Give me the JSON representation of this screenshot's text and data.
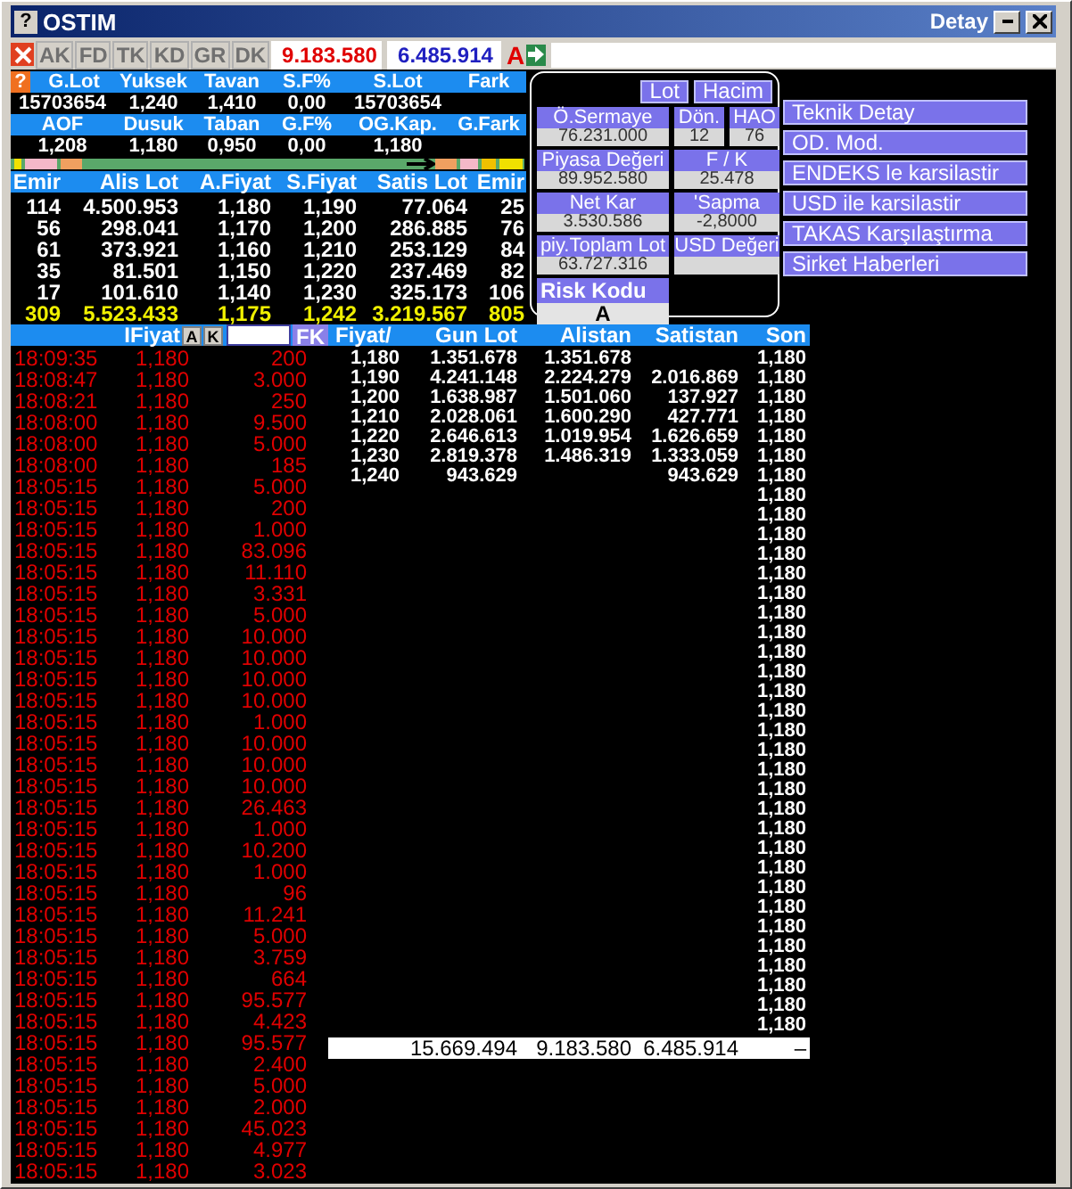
{
  "window": {
    "help": "?",
    "title": "OSTIM",
    "detail_title": "Detay"
  },
  "toolbar": {
    "buttons": [
      {
        "label": "AK",
        "disabled": true
      },
      {
        "label": "FD",
        "disabled": true
      },
      {
        "label": "TK",
        "disabled": true
      },
      {
        "label": "KD",
        "disabled": true
      },
      {
        "label": "GR",
        "disabled": true
      },
      {
        "label": "DK",
        "disabled": true
      }
    ],
    "buy_total": "9.183.580",
    "sell_total": "6.485.914",
    "mode": "A"
  },
  "summary": {
    "help": "?",
    "rows": [
      {
        "kind": "header",
        "cells": [
          "G.Lot",
          "Yuksek",
          "Tavan",
          "S.F%",
          "S.Lot",
          "Fark"
        ]
      },
      {
        "kind": "value",
        "cells": [
          "15703654",
          "1,240",
          "1,410",
          "0,00",
          "15703654"
        ]
      },
      {
        "kind": "header",
        "cells": [
          "AOF",
          "Dusuk",
          "Taban",
          "G.F%",
          "OG.Kap.",
          "G.Fark"
        ]
      },
      {
        "kind": "value",
        "cells": [
          "1,208",
          "1,180",
          "0,950",
          "0,00",
          "1,180"
        ]
      }
    ]
  },
  "order_book": {
    "columns": [
      "Emir",
      "Alis Lot",
      "A.Fiyat",
      "S.Fiyat",
      "Satis Lot",
      "Emir"
    ],
    "rows": [
      {
        "cells": [
          "114",
          "4.500.953",
          "1,180",
          "1,190",
          "77.064",
          "25"
        ],
        "total": false
      },
      {
        "cells": [
          "56",
          "298.041",
          "1,170",
          "1,200",
          "286.885",
          "76"
        ],
        "total": false
      },
      {
        "cells": [
          "61",
          "373.921",
          "1,160",
          "1,210",
          "253.129",
          "84"
        ],
        "total": false
      },
      {
        "cells": [
          "35",
          "81.501",
          "1,150",
          "1,220",
          "237.469",
          "82"
        ],
        "total": false
      },
      {
        "cells": [
          "17",
          "101.610",
          "1,140",
          "1,230",
          "325.173",
          "106"
        ],
        "total": false
      },
      {
        "cells": [
          "309",
          "5.523.433",
          "1,175",
          "1,242",
          "3.219.567",
          "805"
        ],
        "total": true
      }
    ]
  },
  "panel": {
    "toggles": [
      {
        "label": "Lot"
      },
      {
        "label": "Hacim"
      }
    ],
    "fields": [
      {
        "kind": "main",
        "label": "Ö.Sermaye",
        "value": "76.231.000"
      },
      {
        "kind": "small",
        "label": "Dön.",
        "value": "12"
      },
      {
        "kind": "small",
        "label": "HAO",
        "value": "76"
      },
      {
        "kind": "main",
        "label": "Piyasa Değeri",
        "value": "89.952.580"
      },
      {
        "kind": "side",
        "label": "F / K",
        "value": "25.478"
      },
      {
        "kind": "main",
        "label": "Net Kar",
        "value": "3.530.586"
      },
      {
        "kind": "side",
        "label": "'Sapma",
        "value": "-2,8000"
      },
      {
        "kind": "main",
        "label": "piy.Toplam Lot",
        "value": "63.727.316"
      },
      {
        "kind": "side",
        "label": "USD Değeri"
      }
    ],
    "risk": {
      "label": "Risk Kodu",
      "value": "A"
    }
  },
  "actions": [
    "Teknik Detay",
    "OD. Mod.",
    "ENDEKS le karsilastir",
    "USD ile karsilastir",
    "TAKAS Karşılaştırma",
    "Sirket Haberleri"
  ],
  "trades": {
    "price_label": "IFiyat",
    "buttons": [
      "A",
      "K"
    ],
    "filter_button": "FK",
    "rows": [
      {
        "time": "18:09:35",
        "price": "1,180",
        "lot": "200"
      },
      {
        "time": "18:08:47",
        "price": "1,180",
        "lot": "3.000"
      },
      {
        "time": "18:08:21",
        "price": "1,180",
        "lot": "250"
      },
      {
        "time": "18:08:00",
        "price": "1,180",
        "lot": "9.500"
      },
      {
        "time": "18:08:00",
        "price": "1,180",
        "lot": "5.000"
      },
      {
        "time": "18:08:00",
        "price": "1,180",
        "lot": "185"
      },
      {
        "time": "18:05:15",
        "price": "1,180",
        "lot": "5.000"
      },
      {
        "time": "18:05:15",
        "price": "1,180",
        "lot": "200"
      },
      {
        "time": "18:05:15",
        "price": "1,180",
        "lot": "1.000"
      },
      {
        "time": "18:05:15",
        "price": "1,180",
        "lot": "83.096"
      },
      {
        "time": "18:05:15",
        "price": "1,180",
        "lot": "11.110"
      },
      {
        "time": "18:05:15",
        "price": "1,180",
        "lot": "3.331"
      },
      {
        "time": "18:05:15",
        "price": "1,180",
        "lot": "5.000"
      },
      {
        "time": "18:05:15",
        "price": "1,180",
        "lot": "10.000"
      },
      {
        "time": "18:05:15",
        "price": "1,180",
        "lot": "10.000"
      },
      {
        "time": "18:05:15",
        "price": "1,180",
        "lot": "10.000"
      },
      {
        "time": "18:05:15",
        "price": "1,180",
        "lot": "10.000"
      },
      {
        "time": "18:05:15",
        "price": "1,180",
        "lot": "1.000"
      },
      {
        "time": "18:05:15",
        "price": "1,180",
        "lot": "10.000"
      },
      {
        "time": "18:05:15",
        "price": "1,180",
        "lot": "10.000"
      },
      {
        "time": "18:05:15",
        "price": "1,180",
        "lot": "10.000"
      },
      {
        "time": "18:05:15",
        "price": "1,180",
        "lot": "26.463"
      },
      {
        "time": "18:05:15",
        "price": "1,180",
        "lot": "1.000"
      },
      {
        "time": "18:05:15",
        "price": "1,180",
        "lot": "10.200"
      },
      {
        "time": "18:05:15",
        "price": "1,180",
        "lot": "1.000"
      },
      {
        "time": "18:05:15",
        "price": "1,180",
        "lot": "96"
      },
      {
        "time": "18:05:15",
        "price": "1,180",
        "lot": "11.241"
      },
      {
        "time": "18:05:15",
        "price": "1,180",
        "lot": "5.000"
      },
      {
        "time": "18:05:15",
        "price": "1,180",
        "lot": "3.759"
      },
      {
        "time": "18:05:15",
        "price": "1,180",
        "lot": "664"
      },
      {
        "time": "18:05:15",
        "price": "1,180",
        "lot": "95.577"
      },
      {
        "time": "18:05:15",
        "price": "1,180",
        "lot": "4.423"
      },
      {
        "time": "18:05:15",
        "price": "1,180",
        "lot": "95.577"
      },
      {
        "time": "18:05:15",
        "price": "1,180",
        "lot": "2.400"
      },
      {
        "time": "18:05:15",
        "price": "1,180",
        "lot": "5.000"
      },
      {
        "time": "18:05:15",
        "price": "1,180",
        "lot": "2.000"
      },
      {
        "time": "18:05:15",
        "price": "1,180",
        "lot": "45.023"
      },
      {
        "time": "18:05:15",
        "price": "1,180",
        "lot": "4.977"
      },
      {
        "time": "18:05:15",
        "price": "1,180",
        "lot": "3.023"
      }
    ]
  },
  "price_table": {
    "columns": [
      "Fiyat/",
      "Gun Lot",
      "Alistan",
      "Satistan",
      "Son"
    ],
    "rows": [
      {
        "fiyat": "1,180",
        "gun_lot": "1.351.678",
        "alistan": "1.351.678",
        "son": "1,180"
      },
      {
        "fiyat": "1,190",
        "gun_lot": "4.241.148",
        "alistan": "2.224.279",
        "satistan": "2.016.869",
        "son": "1,180"
      },
      {
        "fiyat": "1,200",
        "gun_lot": "1.638.987",
        "alistan": "1.501.060",
        "satistan": "137.927",
        "son": "1,180"
      },
      {
        "fiyat": "1,210",
        "gun_lot": "2.028.061",
        "alistan": "1.600.290",
        "satistan": "427.771",
        "son": "1,180"
      },
      {
        "fiyat": "1,220",
        "gun_lot": "2.646.613",
        "alistan": "1.019.954",
        "satistan": "1.626.659",
        "son": "1,180"
      },
      {
        "fiyat": "1,230",
        "gun_lot": "2.819.378",
        "alistan": "1.486.319",
        "satistan": "1.333.059",
        "son": "1,180"
      },
      {
        "fiyat": "1,240",
        "gun_lot": "943.629",
        "satistan": "943.629",
        "son": "1,180"
      },
      {
        "son": "1,180"
      },
      {
        "son": "1,180"
      },
      {
        "son": "1,180"
      },
      {
        "son": "1,180"
      },
      {
        "son": "1,180"
      },
      {
        "son": "1,180"
      },
      {
        "son": "1,180"
      },
      {
        "son": "1,180"
      },
      {
        "son": "1,180"
      },
      {
        "son": "1,180"
      },
      {
        "son": "1,180"
      },
      {
        "son": "1,180"
      },
      {
        "son": "1,180"
      },
      {
        "son": "1,180"
      },
      {
        "son": "1,180"
      },
      {
        "son": "1,180"
      },
      {
        "son": "1,180"
      },
      {
        "son": "1,180"
      },
      {
        "son": "1,180"
      },
      {
        "son": "1,180"
      },
      {
        "son": "1,180"
      },
      {
        "son": "1,180"
      },
      {
        "son": "1,180"
      },
      {
        "son": "1,180"
      },
      {
        "son": "1,180"
      },
      {
        "son": "1,180"
      },
      {
        "son": "1,180"
      },
      {
        "son": "1,180"
      }
    ],
    "totals": {
      "gun_lot": "15.669.494",
      "alistan": "9.183.580",
      "satistan": "6.485.914",
      "son": "–"
    }
  }
}
